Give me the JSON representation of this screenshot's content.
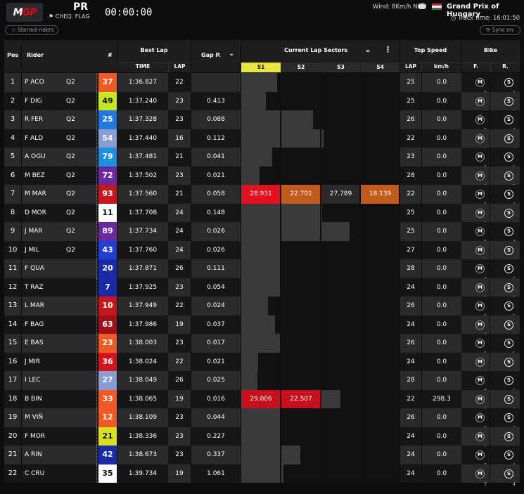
{
  "header": {
    "logo_m": "M",
    "logo_gp": "GP",
    "session": "PR",
    "flag": "CHEQ. FLAG",
    "timer": "00:00:00",
    "wind": "Wind: 8Km/h N",
    "grand_prix": "Grand Prix of Hungary",
    "track_time": "Track time: 16:01:50"
  },
  "subbar": {
    "left_pill": "Starred riders",
    "right_pill": "Sync on"
  },
  "colors": {
    "background": "#0d0d0f",
    "row_dark": "#161618",
    "row_light": "#2a2a2d",
    "header_bg": "#1e1e21",
    "s1_highlight": "#e8e540",
    "sector_red": "#e3101d",
    "sector_orange": "#c25a1c",
    "hungary_flag": [
      "#cd2a3e",
      "#ffffff",
      "#436f4d"
    ]
  },
  "columns": {
    "pos": "Pos",
    "rider": "Rider",
    "num": "#",
    "best_lap": "Best Lap",
    "time": "TIME",
    "lap": "LAP",
    "gap": "Gap P.",
    "current_lap_sectors": "Current Lap Sectors",
    "s1": "S1",
    "s2": "S2",
    "s3": "S3",
    "s4": "S4",
    "top_speed": "Top Speed",
    "ts_lap": "LAP",
    "kmh": "km/h",
    "bike": "Bike",
    "f": "F.",
    "r": "R."
  },
  "rows": [
    {
      "pos": "1",
      "rider": "P ACO",
      "q": "Q2",
      "num": "37",
      "numColor": "#f15a24",
      "time": "1:36.827",
      "lap": "22",
      "gap": "",
      "s": [
        0.93,
        0,
        0,
        0
      ],
      "st": [
        "",
        "",
        "",
        ""
      ],
      "sc": [
        "",
        "",
        "",
        ""
      ],
      "tlap": "25",
      "kmh": "0.0",
      "f": "M",
      "fn": "8",
      "r": "S",
      "rn": "3"
    },
    {
      "pos": "2",
      "rider": "F DIG",
      "q": "Q2",
      "num": "49",
      "numColor": "#c5e620",
      "time": "1:37.240",
      "lap": "23",
      "gap": "0.413",
      "s": [
        0.65,
        0,
        0,
        0
      ],
      "st": [
        "",
        "",
        "",
        ""
      ],
      "sc": [
        "",
        "",
        "",
        ""
      ],
      "tlap": "25",
      "kmh": "0.0",
      "f": "M",
      "fn": "2",
      "r": "S",
      "rn": "2"
    },
    {
      "pos": "3",
      "rider": "R FER",
      "q": "Q2",
      "num": "25",
      "numColor": "#1f7ae0",
      "time": "1:37.328",
      "lap": "23",
      "gap": "0.088",
      "s": [
        1,
        0.82,
        0,
        0
      ],
      "st": [
        "",
        "",
        "",
        ""
      ],
      "sc": [
        "",
        "",
        "",
        ""
      ],
      "tlap": "26",
      "kmh": "0.0",
      "f": "M",
      "fn": "9",
      "r": "S",
      "rn": "4"
    },
    {
      "pos": "4",
      "rider": "F ALD",
      "q": "Q2",
      "num": "54",
      "numColor": "#8a9cd4",
      "time": "1:37.440",
      "lap": "16",
      "gap": "0.112",
      "s": [
        1,
        1,
        0.08,
        0
      ],
      "st": [
        "",
        "",
        "",
        ""
      ],
      "sc": [
        "",
        "",
        "",
        ""
      ],
      "tlap": "22",
      "kmh": "0.0",
      "f": "M",
      "fn": "8",
      "r": "S",
      "rn": "4"
    },
    {
      "pos": "5",
      "rider": "A OGU",
      "q": "Q2",
      "num": "79",
      "numColor": "#1e8fe0",
      "time": "1:37.481",
      "lap": "21",
      "gap": "0.041",
      "s": [
        0.8,
        0,
        0,
        0
      ],
      "st": [
        "",
        "",
        "",
        ""
      ],
      "sc": [
        "",
        "",
        "",
        ""
      ],
      "tlap": "23",
      "kmh": "0.0",
      "f": "M",
      "fn": "9",
      "r": "S",
      "rn": "5"
    },
    {
      "pos": "6",
      "rider": "M BEZ",
      "q": "Q2",
      "num": "72",
      "numColor": "#6a2a9e",
      "time": "1:37.502",
      "lap": "23",
      "gap": "0.021",
      "s": [
        0.48,
        0,
        0,
        0
      ],
      "st": [
        "",
        "",
        "",
        ""
      ],
      "sc": [
        "",
        "",
        "",
        ""
      ],
      "tlap": "28",
      "kmh": "0.0",
      "f": "M",
      "fn": "9",
      "r": "S",
      "rn": "5"
    },
    {
      "pos": "7",
      "rider": "M MAR",
      "q": "Q2",
      "num": "93",
      "numColor": "#c8161d",
      "time": "1:37.560",
      "lap": "21",
      "gap": "0.058",
      "s": [
        1,
        1,
        1,
        1
      ],
      "st": [
        "28.931",
        "22.701",
        "27.789",
        "18.139"
      ],
      "sc": [
        "#e3101d",
        "#c25a1c",
        "#2a2a2d",
        "#c25a1c"
      ],
      "tlap": "22",
      "kmh": "0.0",
      "f": "M",
      "fn": "7",
      "r": "S",
      "rn": "3"
    },
    {
      "pos": "8",
      "rider": "D MOR",
      "q": "Q2",
      "num": "11",
      "numColor": "#ffffff",
      "time": "1:37.708",
      "lap": "24",
      "gap": "0.148",
      "s": [
        1,
        1,
        0.02,
        0
      ],
      "st": [
        "",
        "",
        "",
        ""
      ],
      "sc": [
        "",
        "",
        "",
        ""
      ],
      "tlap": "25",
      "kmh": "0.0",
      "f": "M",
      "fn": "8",
      "r": "S",
      "rn": "4"
    },
    {
      "pos": "9",
      "rider": "J MAR",
      "q": "Q2",
      "num": "89",
      "numColor": "#6a2a9e",
      "time": "1:37.734",
      "lap": "24",
      "gap": "0.026",
      "s": [
        1,
        1,
        0.75,
        0
      ],
      "st": [
        "",
        "",
        "",
        ""
      ],
      "sc": [
        "",
        "",
        "",
        ""
      ],
      "tlap": "25",
      "kmh": "0.0",
      "f": "M",
      "fn": "9",
      "r": "S",
      "rn": "4"
    },
    {
      "pos": "10",
      "rider": "J MIL",
      "q": "Q2",
      "num": "43",
      "numColor": "#1e3fd6",
      "time": "1:37.760",
      "lap": "24",
      "gap": "0.026",
      "s": [
        1,
        0,
        0,
        0
      ],
      "st": [
        "",
        "",
        "",
        ""
      ],
      "sc": [
        "",
        "",
        "",
        ""
      ],
      "tlap": "27",
      "kmh": "0.0",
      "f": "M",
      "fn": "9",
      "r": "S",
      "rn": "4"
    },
    {
      "pos": "11",
      "rider": "F QUA",
      "q": "",
      "num": "20",
      "numColor": "#1a2aa8",
      "time": "1:37.871",
      "lap": "26",
      "gap": "0.111",
      "s": [
        1,
        0,
        0,
        0
      ],
      "st": [
        "",
        "",
        "",
        ""
      ],
      "sc": [
        "",
        "",
        "",
        ""
      ],
      "tlap": "28",
      "kmh": "0.0",
      "f": "M",
      "fn": "9",
      "r": "S",
      "rn": "5"
    },
    {
      "pos": "12",
      "rider": "T RAZ",
      "q": "",
      "num": "7",
      "numColor": "#1a2aa8",
      "time": "1:37.925",
      "lap": "23",
      "gap": "0.054",
      "s": [
        1,
        0,
        0,
        0
      ],
      "st": [
        "",
        "",
        "",
        ""
      ],
      "sc": [
        "",
        "",
        "",
        ""
      ],
      "tlap": "24",
      "kmh": "0.0",
      "f": "M",
      "fn": "9",
      "r": "S",
      "rn": "5"
    },
    {
      "pos": "13",
      "rider": "L MAR",
      "q": "",
      "num": "10",
      "numColor": "#c8161d",
      "time": "1:37.949",
      "lap": "22",
      "gap": "0.024",
      "s": [
        0.7,
        0,
        0,
        0
      ],
      "st": [
        "",
        "",
        "",
        ""
      ],
      "sc": [
        "",
        "",
        "",
        ""
      ],
      "tlap": "26",
      "kmh": "0.0",
      "f": "M",
      "fn": "9",
      "r": "S",
      "rn": "5"
    },
    {
      "pos": "14",
      "rider": "F BAG",
      "q": "",
      "num": "63",
      "numColor": "#a0101a",
      "time": "1:37.986",
      "lap": "19",
      "gap": "0.037",
      "s": [
        0.88,
        0,
        0,
        0
      ],
      "st": [
        "",
        "",
        "",
        ""
      ],
      "sc": [
        "",
        "",
        "",
        ""
      ],
      "tlap": "24",
      "kmh": "0.0",
      "f": "M",
      "fn": "9",
      "r": "S",
      "rn": "4"
    },
    {
      "pos": "15",
      "rider": "E BAS",
      "q": "",
      "num": "23",
      "numColor": "#f15a24",
      "time": "1:38.003",
      "lap": "23",
      "gap": "0.017",
      "s": [
        1,
        0,
        0,
        0
      ],
      "st": [
        "",
        "",
        "",
        ""
      ],
      "sc": [
        "",
        "",
        "",
        ""
      ],
      "tlap": "26",
      "kmh": "0.0",
      "f": "M",
      "fn": "5",
      "r": "S",
      "rn": "5"
    },
    {
      "pos": "16",
      "rider": "J MIR",
      "q": "",
      "num": "36",
      "numColor": "#d4141d",
      "time": "1:38.024",
      "lap": "22",
      "gap": "0.021",
      "s": [
        0.45,
        0,
        0,
        0
      ],
      "st": [
        "",
        "",
        "",
        ""
      ],
      "sc": [
        "",
        "",
        "",
        ""
      ],
      "tlap": "24",
      "kmh": "0.0",
      "f": "M",
      "fn": "4",
      "r": "S",
      "rn": "4"
    },
    {
      "pos": "17",
      "rider": "I LEC",
      "q": "",
      "num": "27",
      "numColor": "#8a9cd4",
      "time": "1:38.049",
      "lap": "26",
      "gap": "0.025",
      "s": [
        0.42,
        0,
        0,
        0
      ],
      "st": [
        "",
        "",
        "",
        ""
      ],
      "sc": [
        "",
        "",
        "",
        ""
      ],
      "tlap": "28",
      "kmh": "0.0",
      "f": "M",
      "fn": "9",
      "r": "S",
      "rn": "5"
    },
    {
      "pos": "18",
      "rider": "B BIN",
      "q": "",
      "num": "33",
      "numColor": "#f15a24",
      "time": "1:38.065",
      "lap": "19",
      "gap": "0.016",
      "s": [
        1,
        1,
        0.5,
        0
      ],
      "st": [
        "29.006",
        "22.507",
        "",
        ""
      ],
      "sc": [
        "#c8101c",
        "#c8101c",
        "",
        ""
      ],
      "tlap": "22",
      "kmh": "298.3",
      "f": "M",
      "fn": "5",
      "r": "S",
      "rn": "1"
    },
    {
      "pos": "19",
      "rider": "M VIÑ",
      "q": "",
      "num": "12",
      "numColor": "#f15a24",
      "time": "1:38.109",
      "lap": "23",
      "gap": "0.044",
      "s": [
        1,
        0,
        0,
        0
      ],
      "st": [
        "",
        "",
        "",
        ""
      ],
      "sc": [
        "",
        "",
        "",
        ""
      ],
      "tlap": "26",
      "kmh": "0.0",
      "f": "M",
      "fn": "3",
      "r": "S",
      "rn": "3"
    },
    {
      "pos": "20",
      "rider": "F MOR",
      "q": "",
      "num": "21",
      "numColor": "#d8e020",
      "time": "1:38.336",
      "lap": "23",
      "gap": "0.227",
      "s": [
        1,
        0,
        0,
        0
      ],
      "st": [
        "",
        "",
        "",
        ""
      ],
      "sc": [
        "",
        "",
        "",
        ""
      ],
      "tlap": "24",
      "kmh": "0.0",
      "f": "M",
      "fn": "5",
      "r": "S",
      "rn": "2"
    },
    {
      "pos": "21",
      "rider": "A RIN",
      "q": "",
      "num": "42",
      "numColor": "#1a2aa8",
      "time": "1:38.673",
      "lap": "23",
      "gap": "0.337",
      "s": [
        1,
        0.5,
        0,
        0
      ],
      "st": [
        "",
        "",
        "",
        ""
      ],
      "sc": [
        "",
        "",
        "",
        ""
      ],
      "tlap": "24",
      "kmh": "0.0",
      "f": "M",
      "fn": "7",
      "r": "S",
      "rn": "3"
    },
    {
      "pos": "22",
      "rider": "C CRU",
      "q": "",
      "num": "35",
      "numColor": "#ffffff",
      "time": "1:39.734",
      "lap": "19",
      "gap": "1.061",
      "s": [
        1,
        0.08,
        0,
        0
      ],
      "st": [
        "",
        "",
        "",
        ""
      ],
      "sc": [
        "",
        "",
        "",
        ""
      ],
      "tlap": "24",
      "kmh": "0.0",
      "f": "M",
      "fn": "7",
      "r": "S",
      "rn": "4"
    }
  ]
}
